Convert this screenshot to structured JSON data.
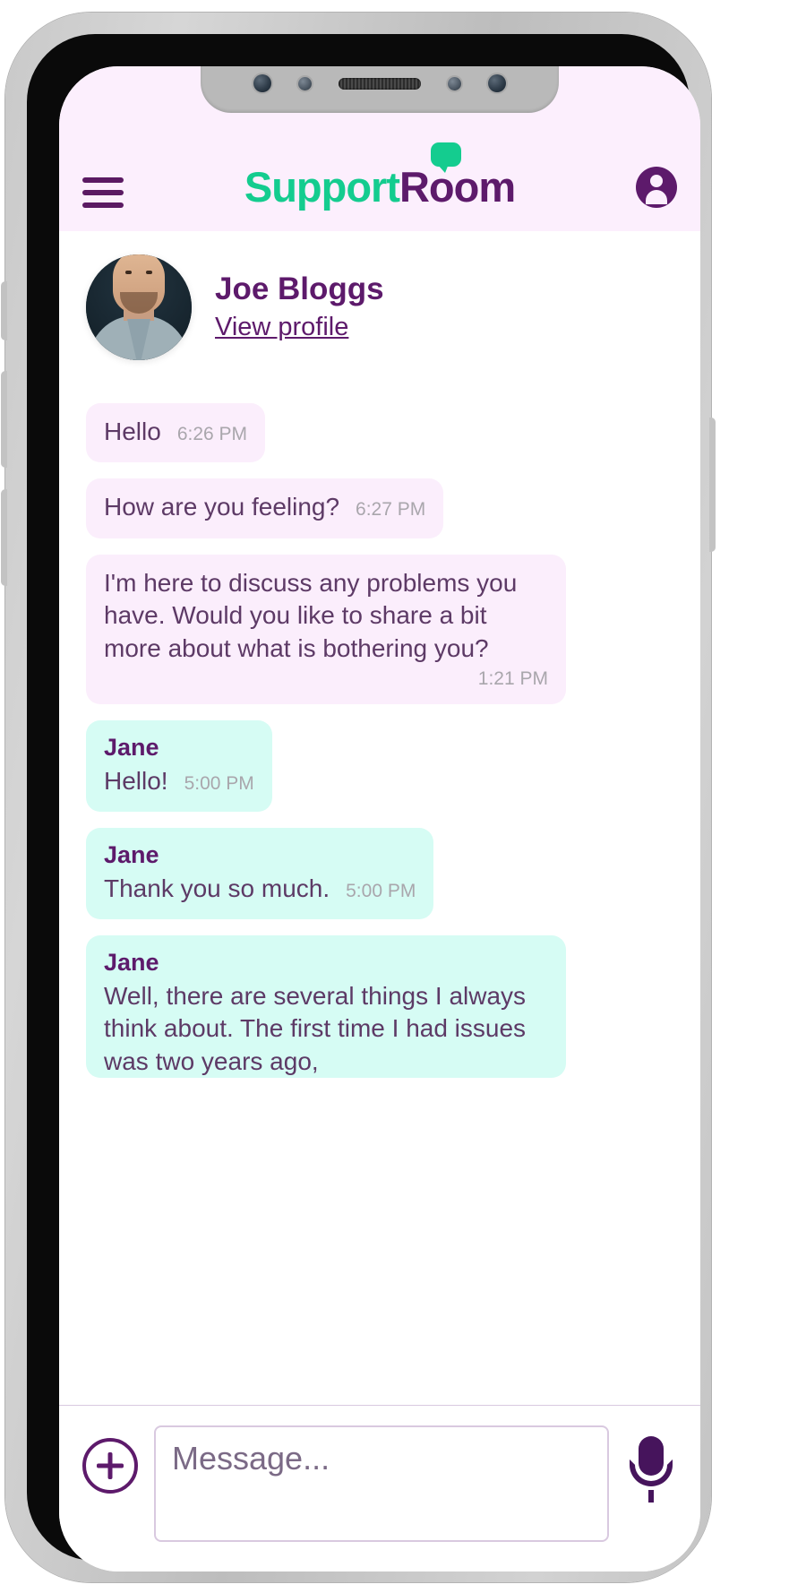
{
  "app": {
    "brand_support": "Support",
    "brand_room": "Room",
    "menu_label": "Menu",
    "account_label": "Account"
  },
  "profile": {
    "name": "Joe Bloggs",
    "view_profile_label": "View profile"
  },
  "messages": [
    {
      "side": "them",
      "sender": "",
      "text": "Hello",
      "time": "6:26 PM",
      "wide": false,
      "clipped": false
    },
    {
      "side": "them",
      "sender": "",
      "text": "How are you feeling?",
      "time": "6:27 PM",
      "wide": false,
      "clipped": false
    },
    {
      "side": "them",
      "sender": "",
      "text": "I'm here to discuss any problems you have. Would you like to share a bit more about what is bothering you?",
      "time": "1:21 PM",
      "wide": true,
      "clipped": false
    },
    {
      "side": "me",
      "sender": "Jane",
      "text": "Hello!",
      "time": "5:00 PM",
      "wide": false,
      "clipped": false
    },
    {
      "side": "me",
      "sender": "Jane",
      "text": "Thank you so much.",
      "time": "5:00 PM",
      "wide": false,
      "clipped": false
    },
    {
      "side": "me",
      "sender": "Jane",
      "text": "Well, there are several things I always think about. The first time I had issues was two years ago,",
      "time": "",
      "wide": true,
      "clipped": true
    }
  ],
  "composer": {
    "add_label": "+",
    "input_value": "",
    "input_placeholder": "Message...",
    "mic_label": "Voice message"
  },
  "colors": {
    "brand_green": "#14cc8f",
    "brand_purple": "#5d1a6b",
    "header_bg": "#fceffd",
    "bubble_them": "#fbeefc",
    "bubble_me": "#d6fcf4",
    "timestamp": "#a9a6ac"
  }
}
